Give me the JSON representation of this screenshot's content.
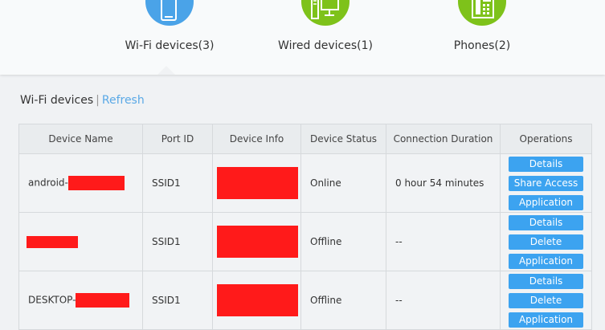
{
  "categories": [
    {
      "label": "Wi-Fi devices(3)",
      "icon": "tablet-icon",
      "color": "#4aa3e8"
    },
    {
      "label": "Wired devices(1)",
      "icon": "desktop-computer-icon",
      "color": "#7ec21a"
    },
    {
      "label": "Phones(2)",
      "icon": "desk-phone-icon",
      "color": "#7ec21a"
    }
  ],
  "section": {
    "title": "Wi-Fi devices",
    "separator": "|",
    "refresh_label": "Refresh"
  },
  "table": {
    "headers": [
      "Device Name",
      "Port ID",
      "Device Info",
      "Device Status",
      "Connection Duration",
      "Operations"
    ],
    "rows": [
      {
        "name_prefix": "android-",
        "port": "SSID1",
        "status": "Online",
        "duration": "0 hour 54 minutes",
        "ops": [
          "Details",
          "Share Access",
          "Application"
        ]
      },
      {
        "name_prefix": "",
        "port": "SSID1",
        "status": "Offline",
        "duration": "--",
        "ops": [
          "Details",
          "Delete",
          "Application"
        ]
      },
      {
        "name_prefix": "DESKTOP-",
        "port": "SSID1",
        "status": "Offline",
        "duration": "--",
        "ops": [
          "Details",
          "Delete",
          "Application"
        ]
      }
    ]
  }
}
